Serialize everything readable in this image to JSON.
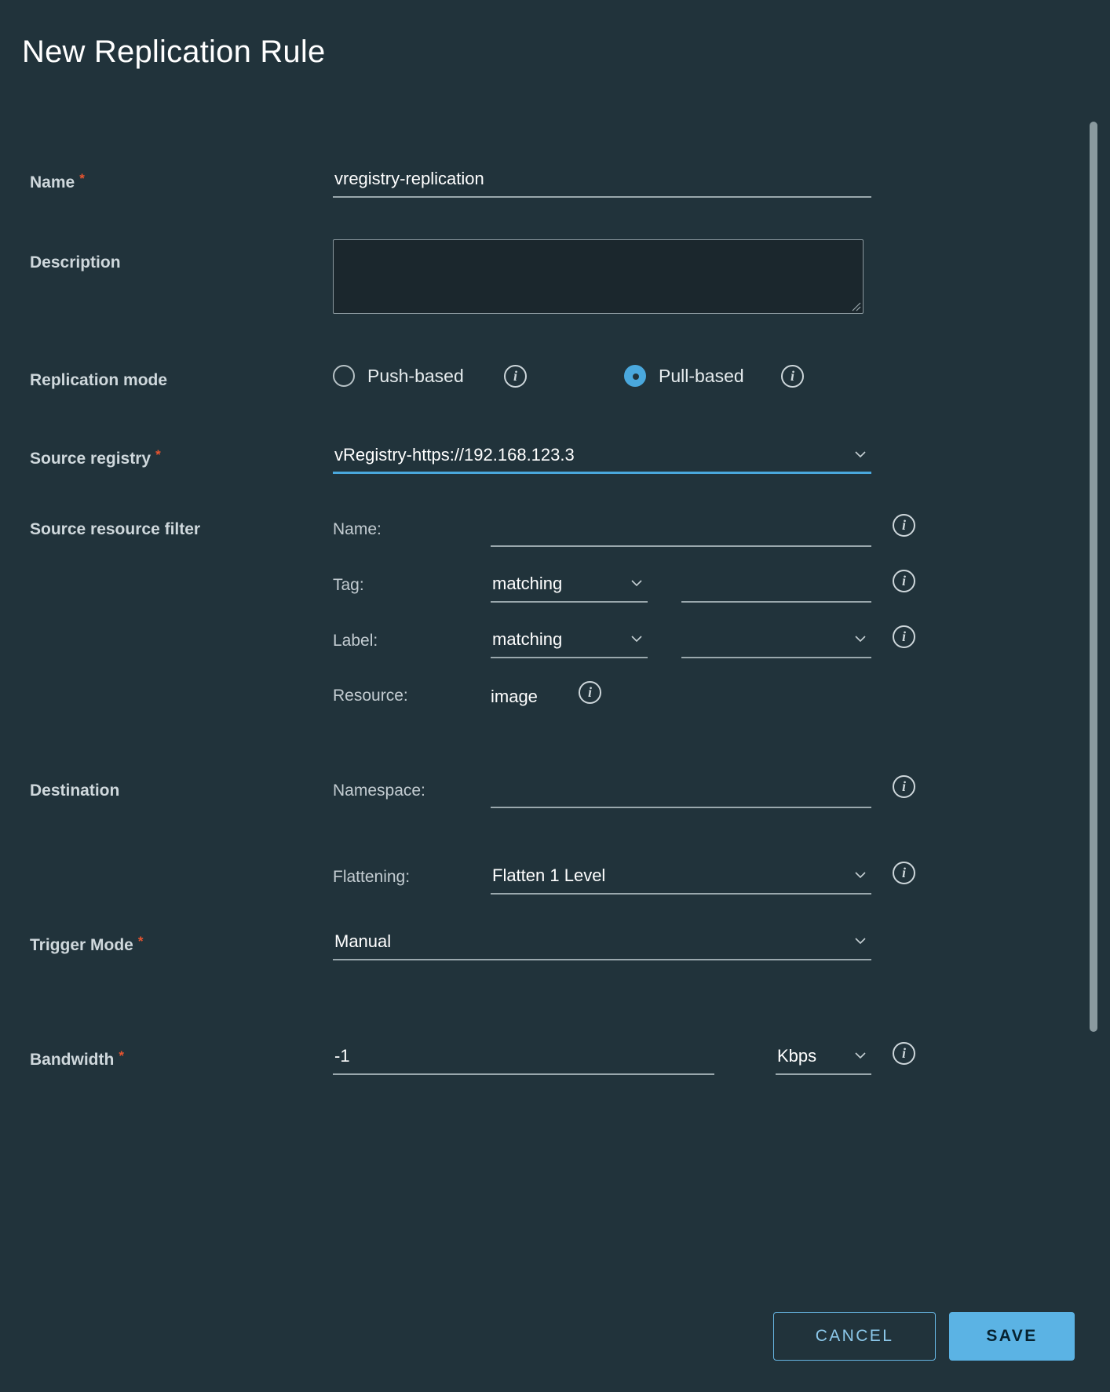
{
  "dialog": {
    "title": "New Replication Rule"
  },
  "fields": {
    "name": {
      "label": "Name",
      "required": "*",
      "value": "vregistry-replication"
    },
    "description": {
      "label": "Description",
      "value": ""
    },
    "replication_mode": {
      "label": "Replication mode",
      "options": [
        {
          "label": "Push-based",
          "selected": false
        },
        {
          "label": "Pull-based",
          "selected": true
        }
      ],
      "info_icon": "info-icon"
    },
    "source_registry": {
      "label": "Source registry",
      "required": "*",
      "value": "vRegistry-https://192.168.123.3",
      "chevron_icon": "chevron-down-icon"
    },
    "source_resource_filter": {
      "label": "Source resource filter",
      "name_row": {
        "label": "Name:",
        "value": ""
      },
      "tag_row": {
        "label": "Tag:",
        "match_mode": "matching",
        "value": ""
      },
      "label_row": {
        "label": "Label:",
        "match_mode": "matching",
        "value": ""
      },
      "resource_row": {
        "label": "Resource:",
        "value": "image"
      }
    },
    "destination": {
      "label": "Destination",
      "namespace_row": {
        "label": "Namespace:",
        "value": ""
      },
      "flattening_row": {
        "label": "Flattening:",
        "value": "Flatten 1 Level"
      }
    },
    "trigger_mode": {
      "label": "Trigger Mode",
      "required": "*",
      "value": "Manual"
    },
    "bandwidth": {
      "label": "Bandwidth",
      "required": "*",
      "value": "-1",
      "unit": "Kbps"
    }
  },
  "footer": {
    "cancel_label": "CANCEL",
    "save_label": "SAVE"
  },
  "colors": {
    "background": "#21333b",
    "accent": "#4aa8dd",
    "required": "#e8542f",
    "save_button": "#5bb3e4"
  }
}
